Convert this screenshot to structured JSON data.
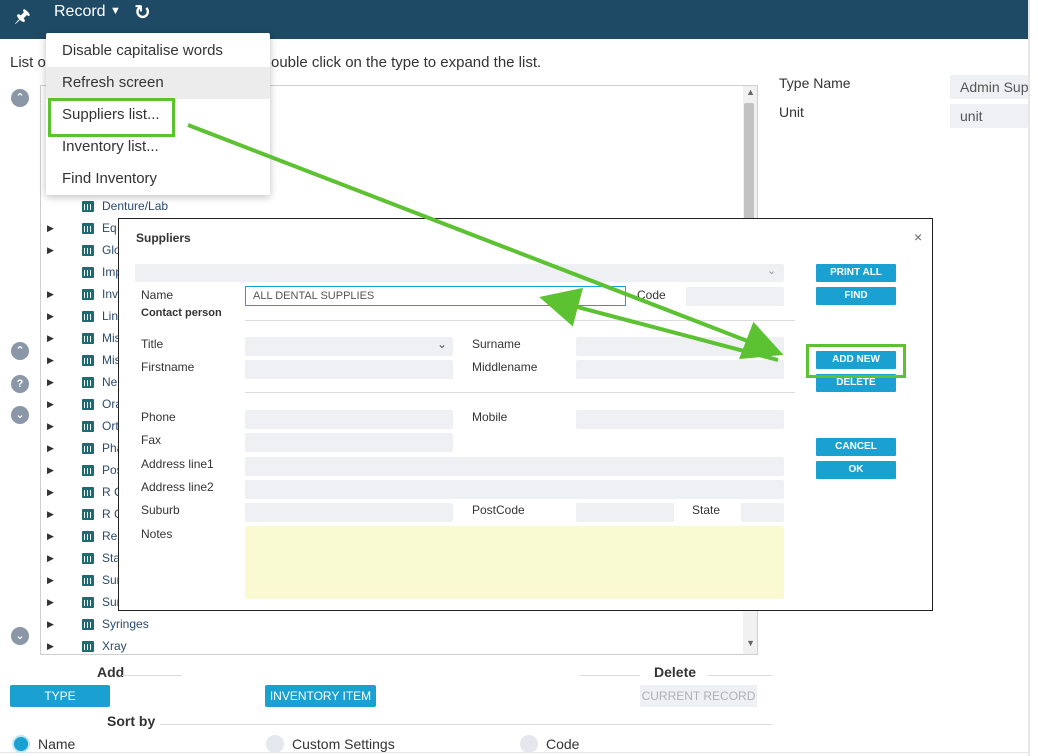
{
  "toolbar": {
    "record_label": "Record"
  },
  "hint": {
    "left": "List o",
    "right": "ouble click on the type to expand the list."
  },
  "menu": {
    "items": [
      "Disable capitalise words",
      "Refresh screen",
      "Suppliers list...",
      "Inventory list...",
      "Find Inventory"
    ]
  },
  "tree": {
    "items": [
      {
        "label": "Denture/Lab",
        "arrow": false
      },
      {
        "label": "Eq",
        "arrow": true
      },
      {
        "label": "Glo",
        "arrow": true
      },
      {
        "label": "Imp",
        "arrow": false
      },
      {
        "label": "Inv",
        "arrow": true
      },
      {
        "label": "Lin",
        "arrow": true
      },
      {
        "label": "Mis",
        "arrow": true
      },
      {
        "label": "Mis",
        "arrow": true
      },
      {
        "label": "Ne",
        "arrow": true
      },
      {
        "label": "Ora",
        "arrow": true
      },
      {
        "label": "Ort",
        "arrow": true
      },
      {
        "label": "Pha",
        "arrow": true
      },
      {
        "label": "Pos",
        "arrow": true
      },
      {
        "label": "R C",
        "arrow": true
      },
      {
        "label": "R C",
        "arrow": true
      },
      {
        "label": "Res",
        "arrow": true
      },
      {
        "label": "Sta",
        "arrow": true
      },
      {
        "label": "Sur",
        "arrow": true
      },
      {
        "label": "Sur",
        "arrow": true
      },
      {
        "label": "Syringes",
        "arrow": true
      },
      {
        "label": "Xray",
        "arrow": true
      }
    ]
  },
  "right_panel": {
    "type_name_label": "Type Name",
    "type_name_value": "Admin Sup",
    "unit_label": "Unit",
    "unit_value": "unit"
  },
  "dialog": {
    "title": "Suppliers",
    "close": "×",
    "name_label": "Name",
    "name_value": "ALL DENTAL SUPPLIES",
    "code_label": "Code",
    "contact_person": "Contact person",
    "title_label": "Title",
    "surname_label": "Surname",
    "firstname_label": "Firstname",
    "middlename_label": "Middlename",
    "phone_label": "Phone",
    "mobile_label": "Mobile",
    "fax_label": "Fax",
    "address1_label": "Address line1",
    "address2_label": "Address line2",
    "suburb_label": "Suburb",
    "postcode_label": "PostCode",
    "state_label": "State",
    "notes_label": "Notes",
    "buttons": {
      "print_all": "PRINT ALL",
      "find": "FIND",
      "add_new": "ADD NEW",
      "delete": "DELETE",
      "cancel": "CANCEL",
      "ok": "OK"
    }
  },
  "bottom": {
    "add_label": "Add",
    "delete_label": "Delete",
    "type_btn": "TYPE",
    "inventory_item_btn": "INVENTORY ITEM",
    "current_record_btn": "CURRENT RECORD",
    "sort_by_label": "Sort by",
    "sort_options": [
      "Name",
      "Custom Settings",
      "Code"
    ]
  },
  "colors": {
    "topbar": "#1e4a66",
    "accent": "#1aa1d1",
    "highlight": "#5cc232",
    "notes_bg": "#fafad2"
  }
}
